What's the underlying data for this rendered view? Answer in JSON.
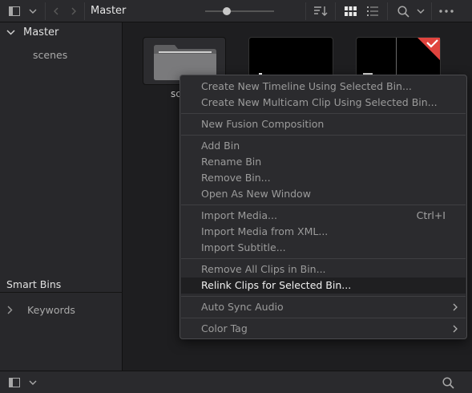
{
  "toolbar": {
    "breadcrumb": "Master"
  },
  "sidebar": {
    "bins": [
      {
        "label": "Master",
        "expanded": true
      },
      {
        "label": "scenes"
      }
    ],
    "smart_bins_header": "Smart Bins",
    "smart_bins": [
      {
        "label": "Keywords"
      }
    ]
  },
  "main": {
    "folder_label_partial": "sc"
  },
  "context_menu": {
    "items": [
      {
        "label": "Create New Timeline Using Selected Bin..."
      },
      {
        "label": "Create New Multicam Clip Using Selected Bin..."
      },
      {
        "label": "New Fusion Composition"
      },
      {
        "label": "Add Bin"
      },
      {
        "label": "Rename Bin"
      },
      {
        "label": "Remove Bin..."
      },
      {
        "label": "Open As New Window"
      },
      {
        "label": "Import Media...",
        "shortcut": "Ctrl+I"
      },
      {
        "label": "Import Media from XML..."
      },
      {
        "label": "Import Subtitle..."
      },
      {
        "label": "Remove All Clips in Bin..."
      },
      {
        "label": "Relink Clips for Selected Bin...",
        "highlighted": true
      },
      {
        "label": "Auto Sync Audio",
        "submenu": true
      },
      {
        "label": "Color Tag",
        "submenu": true
      }
    ]
  },
  "colors": {
    "accent_red": "#e0443e",
    "panel": "#28282b",
    "background": "#1e1e20"
  }
}
